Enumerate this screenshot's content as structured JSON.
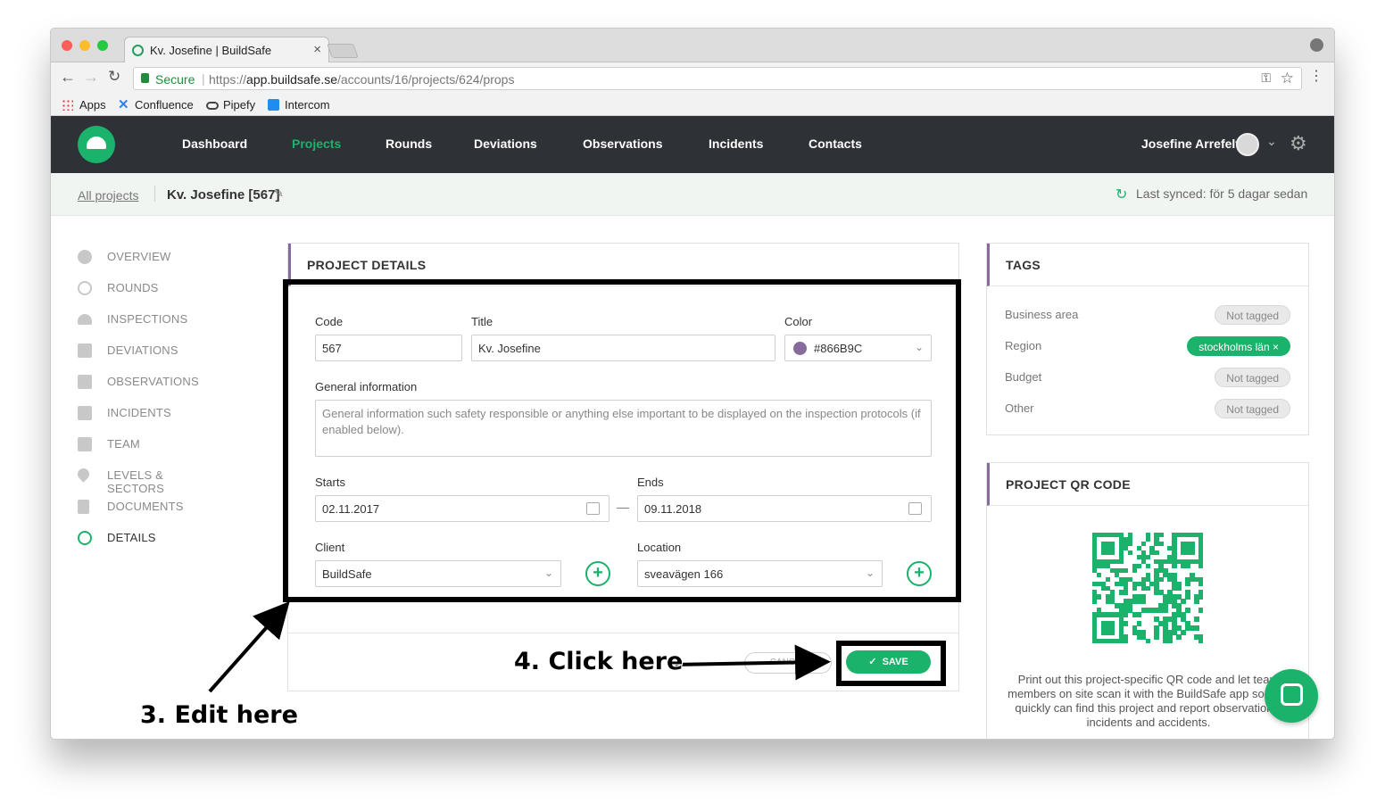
{
  "browser": {
    "tab_title": "Kv. Josefine | BuildSafe",
    "secure_label": "Secure",
    "url_scheme": "https://",
    "url_domain": "app.buildsafe.se",
    "url_path": "/accounts/16/projects/624/props",
    "bookmarks": [
      "Apps",
      "Confluence",
      "Pipefy",
      "Intercom"
    ]
  },
  "nav": {
    "items": [
      "Dashboard",
      "Projects",
      "Rounds",
      "Deviations",
      "Observations",
      "Incidents",
      "Contacts"
    ],
    "active": "Projects",
    "user_name": "Josefine Arrefelt"
  },
  "breadcrumb": {
    "all_projects": "All projects",
    "current": "Kv. Josefine [567]",
    "last_synced": "Last synced: för 5 dagar sedan"
  },
  "sidebar": {
    "items": [
      "OVERVIEW",
      "ROUNDS",
      "INSPECTIONS",
      "DEVIATIONS",
      "OBSERVATIONS",
      "INCIDENTS",
      "TEAM",
      "LEVELS & SECTORS",
      "DOCUMENTS",
      "DETAILS"
    ],
    "active": "DETAILS"
  },
  "project_details": {
    "title": "PROJECT DETAILS",
    "code_label": "Code",
    "code_value": "567",
    "title_label": "Title",
    "title_value": "Kv. Josefine",
    "color_label": "Color",
    "color_value": "#866B9C",
    "color_hex": "#866B9C",
    "general_label": "General information",
    "general_placeholder": "General information such safety responsible or anything else important to be displayed on the inspection protocols (if enabled below).",
    "starts_label": "Starts",
    "starts_value": "02.11.2017",
    "date_dash": "—",
    "ends_label": "Ends",
    "ends_value": "09.11.2018",
    "client_label": "Client",
    "client_value": "BuildSafe",
    "location_label": "Location",
    "location_value": "sveavägen 166",
    "cancel_label": "CANCEL",
    "save_label": "SAVE"
  },
  "tags": {
    "title": "TAGS",
    "rows": [
      {
        "label": "Business area",
        "value": "Not tagged"
      },
      {
        "label": "Region",
        "value": "stockholms län ×"
      },
      {
        "label": "Budget",
        "value": "Not tagged"
      },
      {
        "label": "Other",
        "value": "Not tagged"
      }
    ]
  },
  "qr": {
    "title": "PROJECT QR CODE",
    "description": "Print out this project-specific QR code and let team members on site scan it with the BuildSafe app so they quickly can find this project and report observations, incidents and accidents."
  },
  "annotations": {
    "edit_here": "3. Edit here",
    "click_here": "4. Click here"
  },
  "colors": {
    "brand_green": "#1bb36b",
    "header_dark": "#2e3236",
    "accent_purple": "#866B9C"
  }
}
